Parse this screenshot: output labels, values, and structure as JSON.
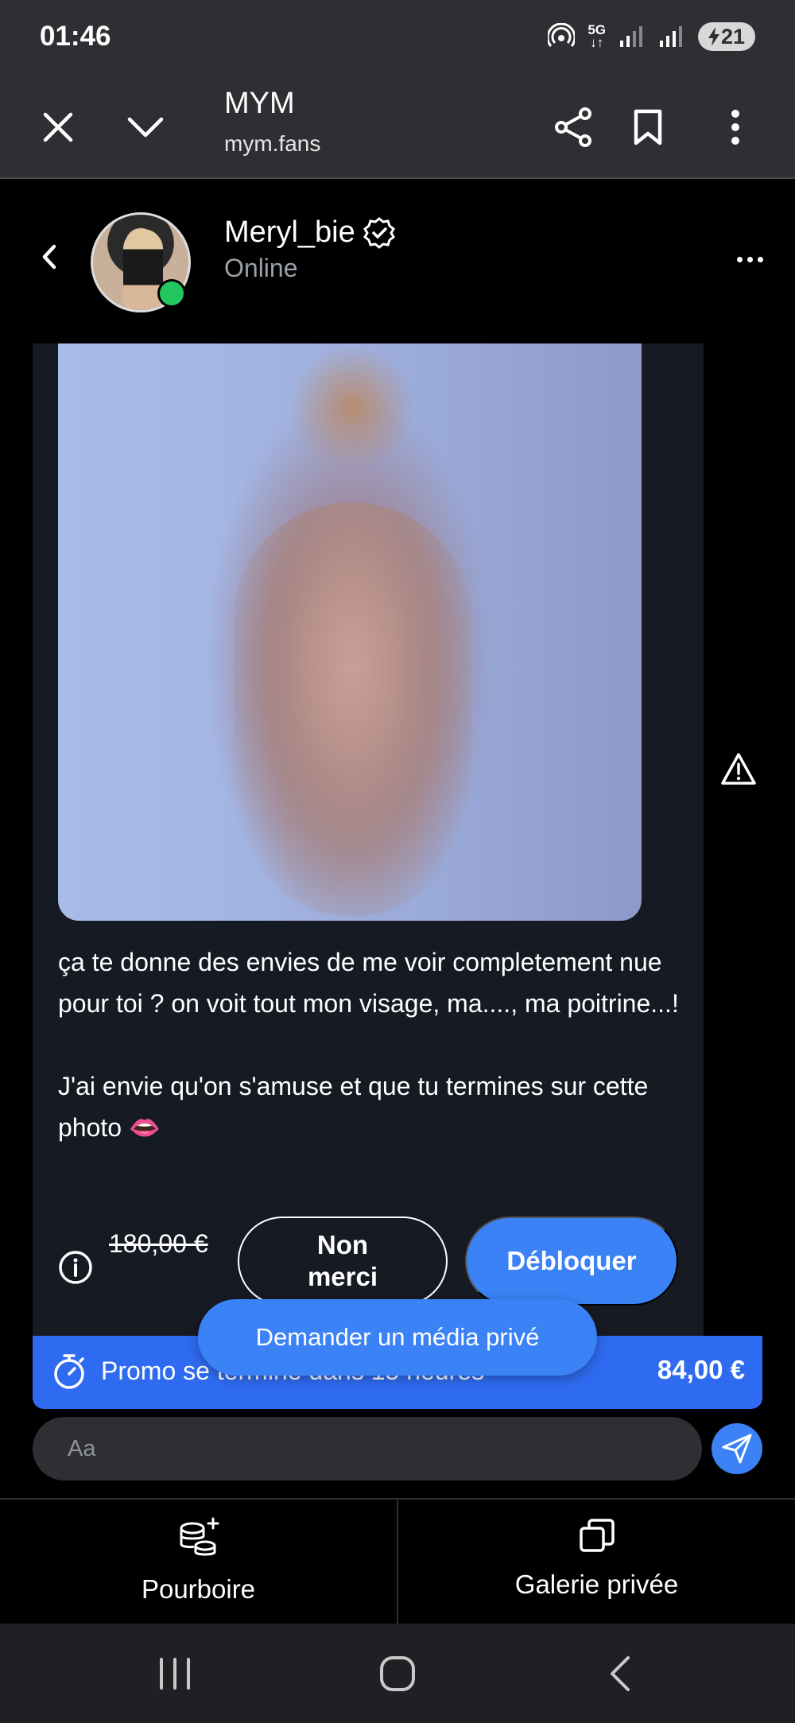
{
  "status_bar": {
    "time": "01:46",
    "network_label": "5G",
    "battery_level": "21"
  },
  "browser": {
    "title": "MYM",
    "url": "mym.fans",
    "icons": [
      "close-icon",
      "chevron-down-icon",
      "share-icon",
      "bookmark-icon",
      "more-vert-icon"
    ]
  },
  "chat_header": {
    "username": "Meryl_bie",
    "presence": "Online",
    "verified": true,
    "online_color": "#22c55e"
  },
  "message": {
    "text": "ça te donne des envies de me voir completement nue pour toi ? on voit tout mon visage, ma...., ma poitrine...!\n\nJ'ai envie qu'on s'amuse et que tu termines sur cette photo 👄",
    "old_price": "180,00 €",
    "decline_label": "Non merci",
    "unlock_label": "Débloquer"
  },
  "promo": {
    "text": "Promo se termine dans 15 heures",
    "price": "84,00 €"
  },
  "floating_action": {
    "label": "Demander un média privé"
  },
  "composer": {
    "placeholder": "Aa"
  },
  "bottom_tabs": [
    {
      "label": "Pourboire",
      "icon": "coins-plus-icon"
    },
    {
      "label": "Galerie privée",
      "icon": "gallery-icon"
    }
  ],
  "colors": {
    "accent": "#3b82f6",
    "promo": "#2f6bf0",
    "card_bg": "#161a23",
    "bar_bg": "#2e2f33"
  }
}
